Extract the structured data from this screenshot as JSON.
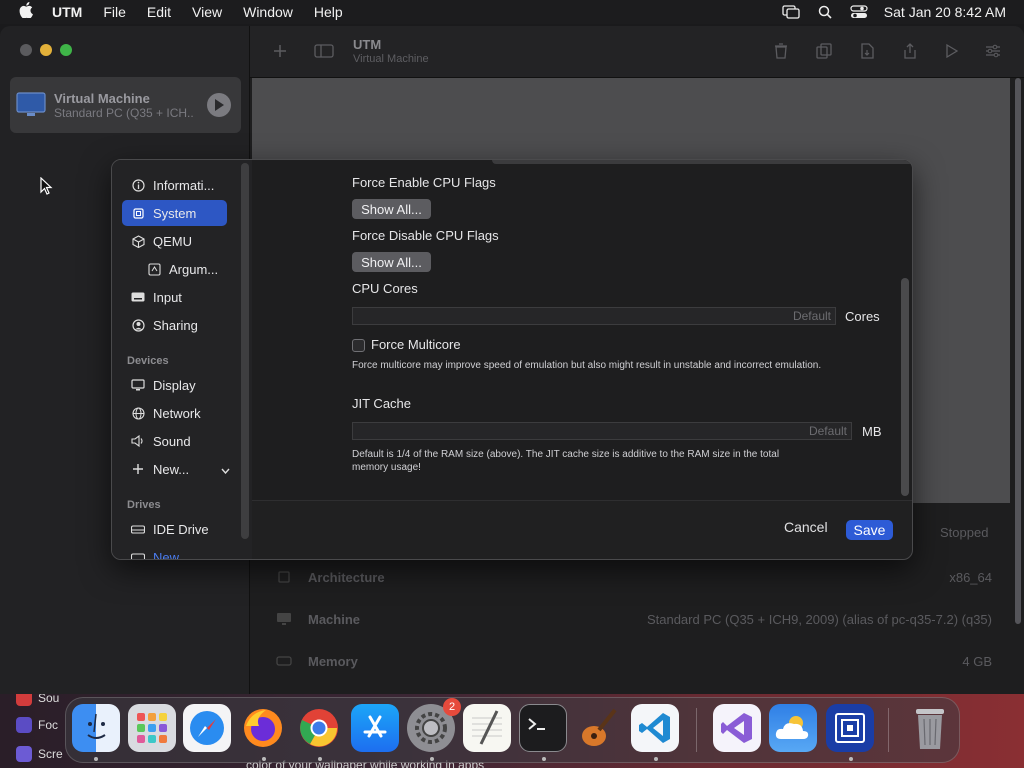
{
  "menubar": {
    "app_name": "UTM",
    "items": [
      "File",
      "Edit",
      "View",
      "Window",
      "Help"
    ],
    "datetime": "Sat Jan 20  8:42 AM"
  },
  "sidebar": {
    "vm": {
      "title": "Virtual Machine",
      "subtitle": "Standard PC (Q35 + ICH..."
    }
  },
  "toolbar": {
    "title": "UTM",
    "subtitle": "Virtual Machine"
  },
  "background": {
    "status": "Stopped",
    "rows": [
      {
        "label": "Architecture",
        "value": "x86_64",
        "icon": "cpu-icon"
      },
      {
        "label": "Machine",
        "value": "Standard PC (Q35 + ICH9, 2009) (alias of pc-q35-7.2) (q35)",
        "icon": "monitor-icon"
      },
      {
        "label": "Memory",
        "value": "4 GB",
        "icon": "memory-icon"
      }
    ]
  },
  "dialog": {
    "nav": [
      {
        "label": "Informati...",
        "icon": "info-icon",
        "selected": false
      },
      {
        "label": "System",
        "icon": "chip-icon",
        "selected": true
      },
      {
        "label": "QEMU",
        "icon": "cube-icon",
        "selected": false
      },
      {
        "label": "Argum...",
        "icon": "terminal-icon",
        "selected": false
      },
      {
        "label": "Input",
        "icon": "keyboard-icon",
        "selected": false
      },
      {
        "label": "Sharing",
        "icon": "person-icon",
        "selected": false
      }
    ],
    "devices_header": "Devices",
    "devices": [
      {
        "label": "Display",
        "icon": "display-icon"
      },
      {
        "label": "Network",
        "icon": "globe-icon"
      },
      {
        "label": "Sound",
        "icon": "speaker-icon"
      },
      {
        "label": "New...",
        "icon": "plus-icon"
      }
    ],
    "drives_header": "Drives",
    "drives": [
      {
        "label": "IDE Drive",
        "icon": "drive-icon"
      },
      {
        "label": "New...",
        "icon": "plus-icon"
      }
    ],
    "force_enable_label": "Force Enable CPU Flags",
    "force_disable_label": "Force Disable CPU Flags",
    "show_all_label": "Show All...",
    "cpu_cores_label": "CPU Cores",
    "cpu_cores_placeholder": "Default",
    "cpu_cores_unit": "Cores",
    "force_multicore_label": "Force Multicore",
    "force_multicore_hint": "Force multicore may improve speed of emulation but also might result in unstable and incorrect emulation.",
    "jit_label": "JIT Cache",
    "jit_placeholder": "Default",
    "jit_unit": "MB",
    "jit_hint_line1": "Default is 1/4 of the RAM size (above). The JIT cache size is additive to the RAM size in the total",
    "jit_hint_line2": "memory usage!",
    "cancel_label": "Cancel",
    "save_label": "Save"
  },
  "dock": {
    "apps": [
      "Finder",
      "Launchpad",
      "Safari",
      "Firefox",
      "Chrome",
      "App Store",
      "System Settings",
      "TextEdit",
      "Terminal",
      "GarageBand",
      "VS Code",
      "Visual Studio",
      "Weather",
      "UTM",
      "Trash"
    ],
    "settings_badge": "2"
  },
  "desktop": {
    "caption": "color of your wallpaper while working in apps",
    "items": [
      "Sou",
      "Foc",
      "Scre"
    ]
  },
  "colors": {
    "accent": "#2d57c4",
    "save": "#2d5bd6"
  }
}
